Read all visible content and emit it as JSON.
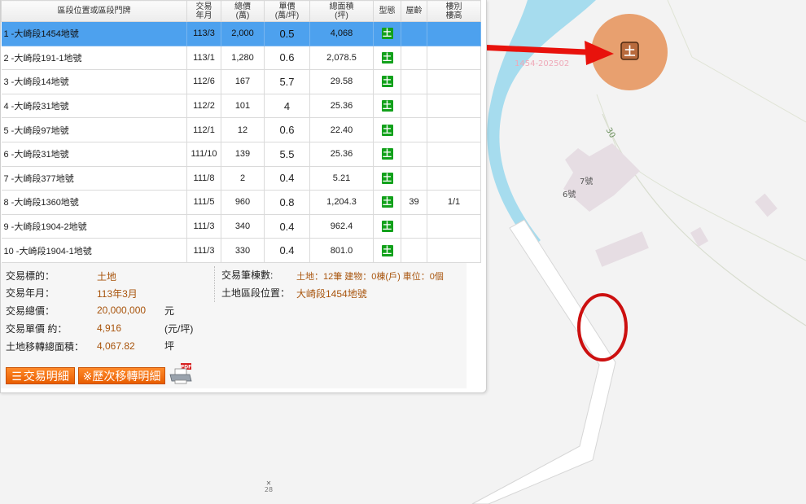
{
  "table": {
    "headers": {
      "location": "區段位置或區段門牌",
      "date_line1": "交易",
      "date_line2": "年月",
      "total_line1": "總價",
      "total_line2": "(萬)",
      "unit_line1": "單價",
      "unit_line2": "(萬/坪)",
      "area_line1": "總面積",
      "area_line2": "(坪)",
      "type": "型態",
      "age": "屋齡",
      "floor_line1": "樓別",
      "floor_line2": "樓高"
    },
    "rows": [
      {
        "location": "1 -大崎段1454地號",
        "date": "113/3",
        "total": "2,000",
        "unit": "0.5",
        "area": "4,068",
        "type": "土",
        "age": "",
        "floor": ""
      },
      {
        "location": "2 -大崎段191-1地號",
        "date": "113/1",
        "total": "1,280",
        "unit": "0.6",
        "area": "2,078.5",
        "type": "土",
        "age": "",
        "floor": ""
      },
      {
        "location": "3 -大崎段14地號",
        "date": "112/6",
        "total": "167",
        "unit": "5.7",
        "area": "29.58",
        "type": "土",
        "age": "",
        "floor": ""
      },
      {
        "location": "4 -大崎段31地號",
        "date": "112/2",
        "total": "101",
        "unit": "4",
        "area": "25.36",
        "type": "土",
        "age": "",
        "floor": ""
      },
      {
        "location": "5 -大崎段97地號",
        "date": "112/1",
        "total": "12",
        "unit": "0.6",
        "area": "22.40",
        "type": "土",
        "age": "",
        "floor": ""
      },
      {
        "location": "6 -大崎段31地號",
        "date": "111/10",
        "total": "139",
        "unit": "5.5",
        "area": "25.36",
        "type": "土",
        "age": "",
        "floor": ""
      },
      {
        "location": "7 -大崎段377地號",
        "date": "111/8",
        "total": "2",
        "unit": "0.4",
        "area": "5.21",
        "type": "土",
        "age": "",
        "floor": ""
      },
      {
        "location": "8 -大崎段1360地號",
        "date": "111/5",
        "total": "960",
        "unit": "0.8",
        "area": "1,204.3",
        "type": "土",
        "age": "39",
        "floor": "1/1"
      },
      {
        "location": "9 -大崎段1904-2地號",
        "date": "111/3",
        "total": "340",
        "unit": "0.4",
        "area": "962.4",
        "type": "土",
        "age": "",
        "floor": ""
      },
      {
        "location": "10 -大崎段1904-1地號",
        "date": "111/3",
        "total": "330",
        "unit": "0.4",
        "area": "801.0",
        "type": "土",
        "age": "",
        "floor": ""
      }
    ],
    "selected_row": 1
  },
  "detail": {
    "target_label": "交易標的：",
    "target_value": "土地",
    "date_label": "交易年月：",
    "date_value": "113年3月",
    "total_label": "交易總價：",
    "total_value": "20,000,000",
    "total_unit": "元",
    "unit_label": "交易單價 約：",
    "unit_value": "4,916",
    "unit_unit": "(元/坪)",
    "area_label": "土地移轉總面積：",
    "area_value": "4,067.82",
    "area_unit": "坪",
    "count_label": "交易筆棟數:",
    "count_value": "土地：12筆 建物：0棟(戶) 車位：0個",
    "location_label": "土地區段位置：",
    "location_value": "大崎段1454地號"
  },
  "buttons": {
    "detail_label": "交易明細",
    "history_label": "※歷次移轉明細",
    "pdf_badge": "PDF"
  },
  "map": {
    "marker_label": "土",
    "marker_caption": "1454-202502",
    "road_number": "30",
    "bldg_7": "7號",
    "bldg_6": "6號",
    "bottom_glyph": "✕",
    "bottom_label": "28"
  },
  "colors": {
    "river": "#a6dcee",
    "marker_fill": "#e8a06f",
    "marker_badge": "#b86a3c",
    "arrow": "#e8120c",
    "ellipse": "#cc1010",
    "selected_row": "#4da1ee",
    "badge_green": "#12a11b",
    "accent_orange": "#a8540c"
  }
}
